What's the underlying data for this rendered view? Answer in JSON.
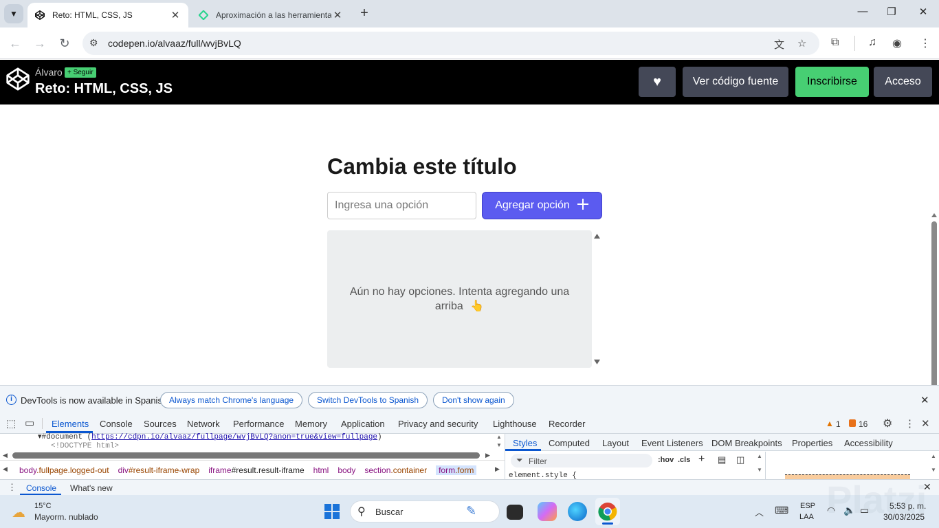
{
  "browser": {
    "tabs": [
      {
        "title": "Reto: HTML, CSS, JS",
        "active": true
      },
      {
        "title": "Aproximación a las herramienta",
        "active": false
      }
    ],
    "url": "codepen.io/alvaaz/full/wvjBvLQ"
  },
  "codepen": {
    "author": "Álvaro",
    "follow_label": "+ Seguir",
    "pen_title": "Reto: HTML, CSS, JS",
    "buttons": {
      "view_source": "Ver código fuente",
      "signup": "Inscribirse",
      "login": "Acceso"
    },
    "colors": {
      "signup": "#47cf73",
      "dark_button": "#444857"
    }
  },
  "app": {
    "title": "Cambia este título",
    "input_placeholder": "Ingresa una opción",
    "add_button": "Agregar opción",
    "empty_message": "Aún no hay opciones. Intenta agregando una arriba",
    "empty_emoji": "👆",
    "accent": "#5b5bf0"
  },
  "devtools": {
    "banner": {
      "message": "DevTools is now available in Spanish!",
      "match_language": "Always match Chrome's language",
      "switch_language": "Switch DevTools to Spanish",
      "dont_show": "Don't show again"
    },
    "tabs": [
      "Elements",
      "Console",
      "Sources",
      "Network",
      "Performance",
      "Memory",
      "Application",
      "Privacy and security",
      "Lighthouse",
      "Recorder"
    ],
    "warnings": "1",
    "issues": "16",
    "dom": {
      "document": "#document",
      "document_url": "https://cdpn.io/alvaaz/fullpage/wvjBvLQ?anon=true&view=fullpage",
      "doctype": "<!DOCTYPE html>"
    },
    "styles_tabs": [
      "Styles",
      "Computed",
      "Layout",
      "Event Listeners",
      "DOM Breakpoints",
      "Properties",
      "Accessibility"
    ],
    "filter_placeholder": "Filter",
    "hov": ":hov",
    "cls": ".cls",
    "element_style": "element.style {",
    "breadcrumbs": [
      {
        "tag": "body",
        "rest": ".fullpage.logged-out"
      },
      {
        "tag": "div",
        "rest": "#result-iframe-wrap"
      },
      {
        "tag": "iframe",
        "rest": "#result.result-iframe"
      },
      {
        "tag": "html",
        "rest": ""
      },
      {
        "tag": "body",
        "rest": ""
      },
      {
        "tag": "section",
        "rest": ".container"
      },
      {
        "tag": "form",
        "rest": ".form"
      }
    ],
    "drawer_tabs": [
      "Console",
      "What's new"
    ]
  },
  "taskbar": {
    "weather_temp": "15°C",
    "weather_desc": "Mayorm. nublado",
    "search": "Buscar",
    "lang": "ESP",
    "lang_sub": "LAA",
    "time": "5:53 p. m.",
    "date": "30/03/2025",
    "watermark": "Platzi"
  }
}
